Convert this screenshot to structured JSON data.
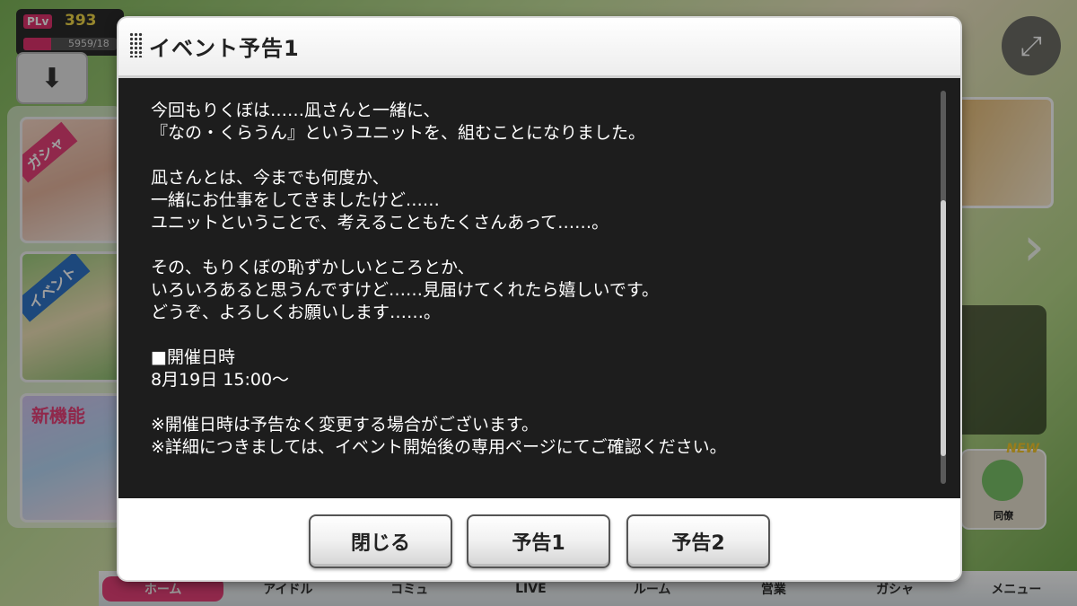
{
  "hud": {
    "plv_label": "PLv",
    "plv_value": "393",
    "stamina_text": "5959/18",
    "stamina_fraction": 0.3
  },
  "side_banners": {
    "gacha_tag": "ガシャ",
    "event_tag": "イベント",
    "new_text": "新機能"
  },
  "dojo": {
    "new_badge": "NEW",
    "label": "同僚"
  },
  "bottom_nav": [
    "ホーム",
    "アイドル",
    "コミュ",
    "LIVE",
    "ルーム",
    "営業",
    "ガシャ",
    "メニュー"
  ],
  "dialog": {
    "title": "イベント予告1",
    "lines": [
      "今回もりくぼは……凪さんと一緒に、",
      "『なの・くらうん』というユニットを、組むことになりました。",
      "",
      "凪さんとは、今までも何度か、",
      "一緒にお仕事をしてきましたけど……",
      "ユニットということで、考えることもたくさんあって……。",
      "",
      "その、もりくぼの恥ずかしいところとか、",
      "いろいろあると思うんですけど……見届けてくれたら嬉しいです。",
      "どうぞ、よろしくお願いします……。",
      "",
      "■開催日時",
      "8月19日 15:00～",
      "",
      "※開催日時は予告なく変更する場合がございます。",
      "※詳細につきましては、イベント開始後の専用ページにてご確認ください。"
    ],
    "scroll_position": 0.8,
    "scroll_thumb_size": 0.65,
    "buttons": {
      "close": "閉じる",
      "notice1": "予告1",
      "notice2": "予告2"
    }
  }
}
